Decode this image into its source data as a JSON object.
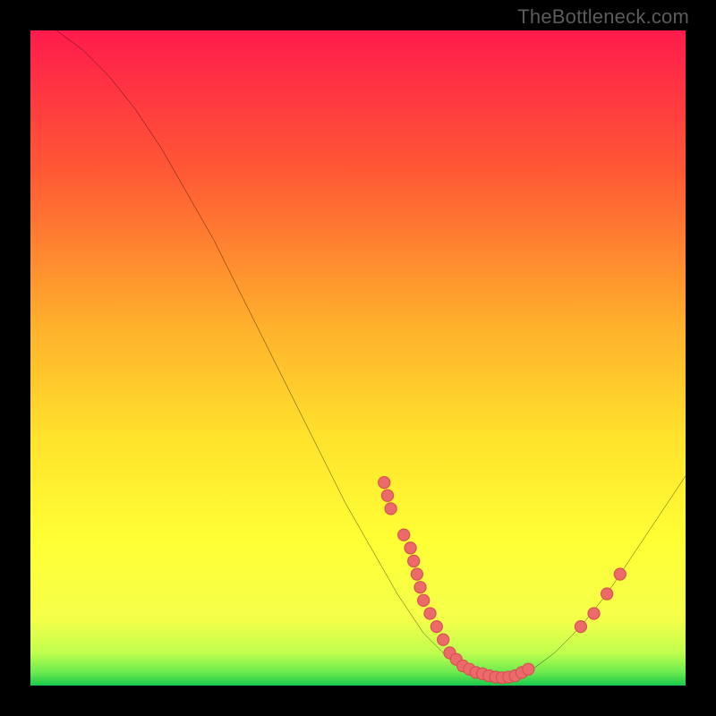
{
  "watermark": "TheBottleneck.com",
  "colors": {
    "top": "#ff1b4c",
    "mid1": "#ff7a2e",
    "mid2": "#ffd12e",
    "mid3": "#ffff2e",
    "mid4": "#d9ff40",
    "bottom": "#18c94c",
    "curve_stroke": "#000000",
    "marker_fill": "#ec6a6a",
    "marker_stroke": "#d74f4f"
  },
  "chart_data": {
    "type": "line",
    "title": "",
    "xlabel": "",
    "ylabel": "",
    "xlim": [
      0,
      100
    ],
    "ylim": [
      0,
      100
    ],
    "curve": [
      {
        "x": 4,
        "y": 100
      },
      {
        "x": 8,
        "y": 97
      },
      {
        "x": 12,
        "y": 93
      },
      {
        "x": 16,
        "y": 88
      },
      {
        "x": 20,
        "y": 82
      },
      {
        "x": 24,
        "y": 75
      },
      {
        "x": 28,
        "y": 68
      },
      {
        "x": 32,
        "y": 60
      },
      {
        "x": 36,
        "y": 52
      },
      {
        "x": 40,
        "y": 44
      },
      {
        "x": 44,
        "y": 36
      },
      {
        "x": 48,
        "y": 28
      },
      {
        "x": 52,
        "y": 21
      },
      {
        "x": 56,
        "y": 14
      },
      {
        "x": 60,
        "y": 8
      },
      {
        "x": 64,
        "y": 4
      },
      {
        "x": 68,
        "y": 1.5
      },
      {
        "x": 72,
        "y": 1
      },
      {
        "x": 76,
        "y": 2
      },
      {
        "x": 80,
        "y": 5
      },
      {
        "x": 84,
        "y": 9
      },
      {
        "x": 88,
        "y": 14
      },
      {
        "x": 92,
        "y": 20
      },
      {
        "x": 96,
        "y": 26
      },
      {
        "x": 100,
        "y": 32
      }
    ],
    "markers": [
      {
        "x": 54,
        "y": 31
      },
      {
        "x": 54.5,
        "y": 29
      },
      {
        "x": 55,
        "y": 27
      },
      {
        "x": 57,
        "y": 23
      },
      {
        "x": 58,
        "y": 21
      },
      {
        "x": 58.5,
        "y": 19
      },
      {
        "x": 59,
        "y": 17
      },
      {
        "x": 59.5,
        "y": 15
      },
      {
        "x": 60,
        "y": 13
      },
      {
        "x": 61,
        "y": 11
      },
      {
        "x": 62,
        "y": 9
      },
      {
        "x": 63,
        "y": 7
      },
      {
        "x": 64,
        "y": 5
      },
      {
        "x": 65,
        "y": 4
      },
      {
        "x": 66,
        "y": 3
      },
      {
        "x": 67,
        "y": 2.5
      },
      {
        "x": 68,
        "y": 2
      },
      {
        "x": 69,
        "y": 1.8
      },
      {
        "x": 70,
        "y": 1.5
      },
      {
        "x": 71,
        "y": 1.3
      },
      {
        "x": 72,
        "y": 1.2
      },
      {
        "x": 73,
        "y": 1.3
      },
      {
        "x": 74,
        "y": 1.5
      },
      {
        "x": 75,
        "y": 2
      },
      {
        "x": 76,
        "y": 2.5
      },
      {
        "x": 84,
        "y": 9
      },
      {
        "x": 86,
        "y": 11
      },
      {
        "x": 88,
        "y": 14
      },
      {
        "x": 90,
        "y": 17
      }
    ]
  }
}
